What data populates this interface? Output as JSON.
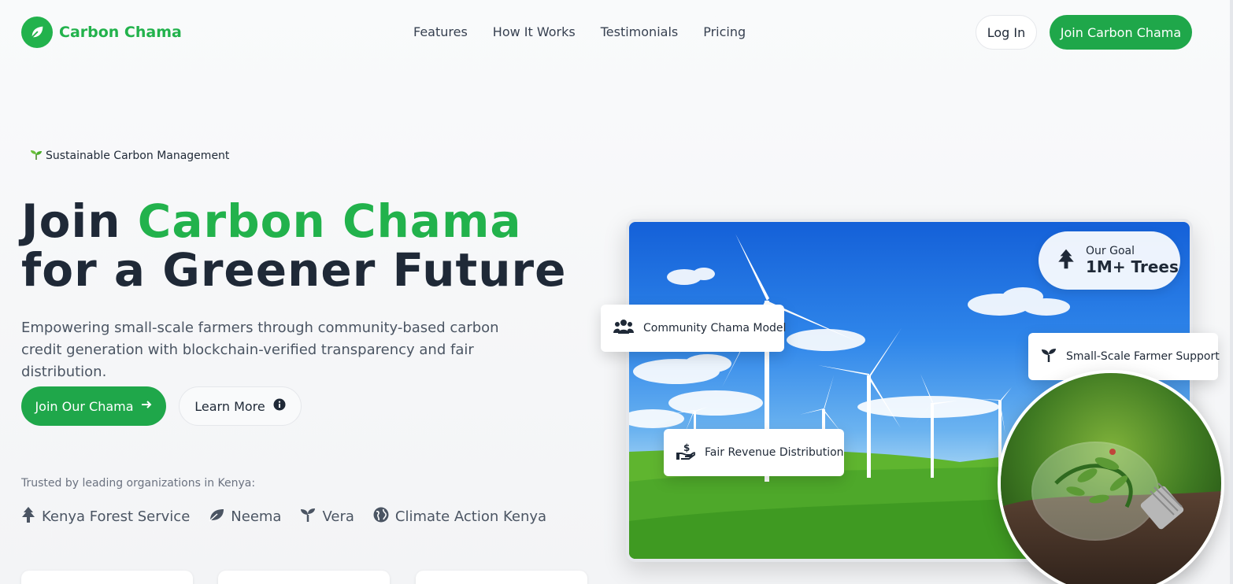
{
  "brand": {
    "name": "Carbon Chama",
    "color": "#22b24c",
    "icon": "leaf-icon"
  },
  "nav": {
    "items": [
      "Features",
      "How It Works",
      "Testimonials",
      "Pricing"
    ]
  },
  "header": {
    "login_label": "Log In",
    "join_label": "Join Carbon Chama"
  },
  "hero": {
    "tag_icon": "seedling-emoji",
    "tag": "Sustainable Carbon Management",
    "title_part1": "Join ",
    "title_highlight": "Carbon Chama",
    "title_part2": " for a Greener Future",
    "description": "Empowering small-scale farmers through community-based carbon credit generation with blockchain-verified transparency and fair distribution.",
    "primary_button": "Join Our Chama",
    "secondary_button": "Learn More"
  },
  "trusted": {
    "label": "Trusted by leading organizations in Kenya:",
    "partners": [
      {
        "name": "Kenya Forest Service",
        "icon": "tree-icon"
      },
      {
        "name": "Neema",
        "icon": "leaf-icon"
      },
      {
        "name": "Vera",
        "icon": "seedling-icon"
      },
      {
        "name": "Climate Action Kenya",
        "icon": "globe-icon"
      }
    ]
  },
  "showcase": {
    "goal_label": "Our Goal",
    "goal_value": "1M+ Trees",
    "feature_community": "Community Chama Model",
    "feature_farmer": "Small-Scale Farmer Support",
    "feature_revenue": "Fair Revenue Distribution"
  },
  "colors": {
    "accent": "#1fa74a",
    "text": "#1f2937",
    "muted": "#4b5563"
  }
}
